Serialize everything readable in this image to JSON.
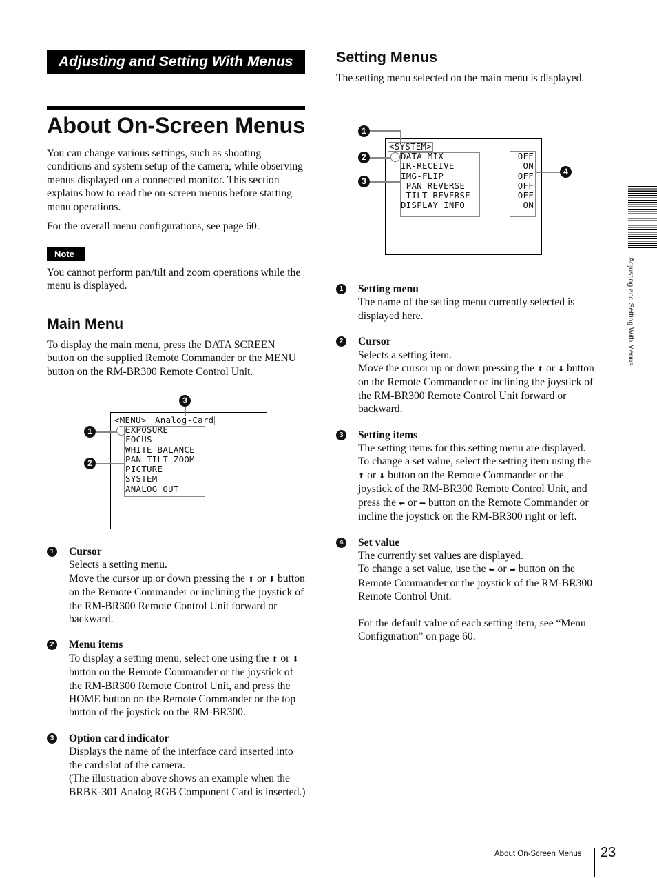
{
  "section_banner": "Adjusting and Setting With Menus",
  "page_title": "About On-Screen Menus",
  "intro": {
    "paragraph_1": "You can change various settings, such as shooting conditions and system setup of the camera, while observing menus displayed on a connected monitor. This section explains how to read the on-screen menus before starting menu operations.",
    "paragraph_2": "For the overall menu configurations, see page 60."
  },
  "note": {
    "label": "Note",
    "text": "You cannot perform pan/tilt and zoom operations while the menu is displayed."
  },
  "main_menu": {
    "heading": "Main Menu",
    "description": "To display the main menu, press the DATA SCREEN button on the supplied Remote Commander or the MENU button on the RM-BR300 Remote Control Unit.",
    "screen": {
      "header_label": "<MENU>",
      "card_label": "Analog-Card",
      "cursor_symbol": ">",
      "items": [
        "EXPOSURE",
        "FOCUS",
        "WHITE BALANCE",
        "PAN TILT ZOOM",
        "PICTURE",
        "SYSTEM",
        "ANALOG OUT"
      ],
      "callouts": [
        "1",
        "2",
        "3"
      ]
    },
    "legend": [
      {
        "num": "1",
        "title": "Cursor",
        "lines": [
          "Selects a setting menu.",
          "Move the cursor up or down pressing the {up} or {down} button on the Remote Commander or inclining the joystick of the RM-BR300 Remote Control Unit forward or backward."
        ]
      },
      {
        "num": "2",
        "title": "Menu items",
        "lines": [
          "To display a setting menu, select one using the {up} or {down} button on the Remote Commander or the joystick of the RM-BR300 Remote Control Unit, and press the HOME button on the Remote Commander or the top button of the joystick on the RM-BR300."
        ]
      },
      {
        "num": "3",
        "title": "Option card indicator",
        "lines": [
          "Displays the name of the interface card inserted into the card slot of the camera.",
          "(The illustration above shows an example when the BRBK-301 Analog RGB Component Card is inserted.)"
        ]
      }
    ]
  },
  "setting_menus": {
    "heading": "Setting Menus",
    "description": "The setting menu selected on the main menu is displayed.",
    "screen": {
      "header_label": "<SYSTEM>",
      "cursor_symbol": ">",
      "items": [
        "DATA MIX",
        "IR-RECEIVE",
        "IMG-FLIP",
        " PAN REVERSE",
        " TILT REVERSE",
        "DISPLAY INFO"
      ],
      "values": [
        "OFF",
        "ON",
        "OFF",
        "OFF",
        "OFF",
        "ON"
      ],
      "callouts": [
        "1",
        "2",
        "3",
        "4"
      ]
    },
    "legend": [
      {
        "num": "1",
        "title": "Setting menu",
        "lines": [
          "The name of the setting menu currently selected is displayed here."
        ]
      },
      {
        "num": "2",
        "title": "Cursor",
        "lines": [
          "Selects a setting item.",
          "Move the cursor up or down pressing the {up} or {down} button on the Remote Commander or inclining the joystick of the RM-BR300 Remote Control Unit forward or backward."
        ]
      },
      {
        "num": "3",
        "title": "Setting items",
        "lines": [
          "The setting items for this setting menu are displayed.",
          "To change a set value, select the setting item using the {up} or {down} button on the Remote Commander or the joystick of the RM-BR300 Remote Control Unit, and press the {left} or {right} button on the Remote Commander or incline the joystick on the RM-BR300 right or left."
        ]
      },
      {
        "num": "4",
        "title": "Set value",
        "lines": [
          "The currently set values are displayed.",
          "To change a set value, use the {left} or {right} button on the Remote Commander or the joystick of the RM-BR300 Remote Control Unit."
        ],
        "footnote": "For the default value of each setting item, see “Menu Configuration” on page 60."
      }
    ]
  },
  "arrow_glyphs": {
    "up": "⬆",
    "down": "⬇",
    "left": "⬅",
    "right": "➡"
  },
  "side_tab": {
    "label": "Adjusting and Setting With Menus"
  },
  "footer": {
    "section_label": "About On-Screen Menus",
    "page_number": "23"
  }
}
